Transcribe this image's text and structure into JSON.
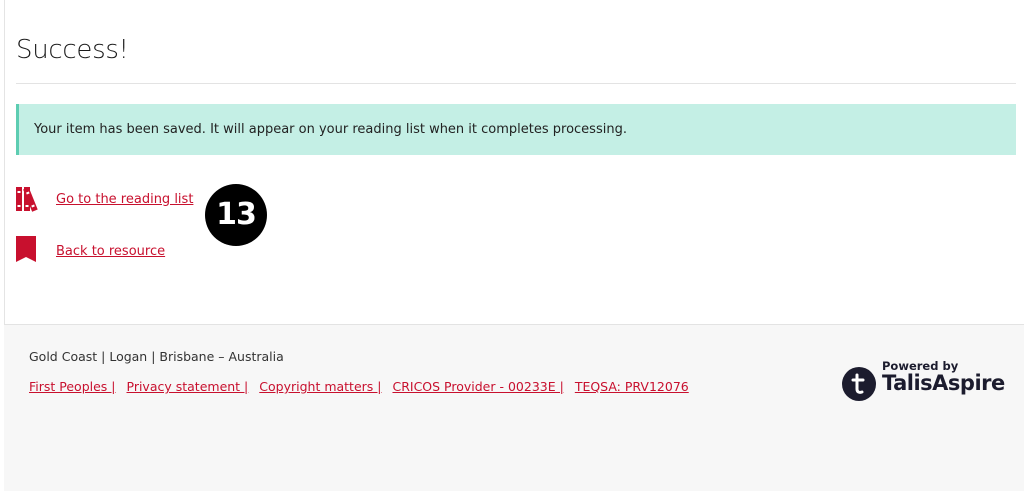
{
  "page": {
    "title": "Success!"
  },
  "alert": {
    "message": "Your item has been saved. It will appear on your reading list when it completes processing."
  },
  "actions": [
    {
      "label": "Go to the reading list",
      "icon": "books-icon"
    },
    {
      "label": "Back to resource",
      "icon": "bookmark-icon"
    }
  ],
  "step_badge": "13",
  "footer": {
    "location": "Gold Coast | Logan | Brisbane – Australia",
    "links": [
      "First Peoples |",
      "Privacy statement |",
      "Copyright matters |",
      "CRICOS Provider - 00233E |",
      "TEQSA: PRV12076"
    ],
    "powered_by": "Powered by",
    "brand_name": "TalisAspire"
  },
  "colors": {
    "link": "#c8102e",
    "alert_bg": "#c4efe5",
    "alert_border": "#5dcdb2",
    "footer_bg": "#f7f7f7",
    "brand_dark": "#1c1c2e"
  }
}
